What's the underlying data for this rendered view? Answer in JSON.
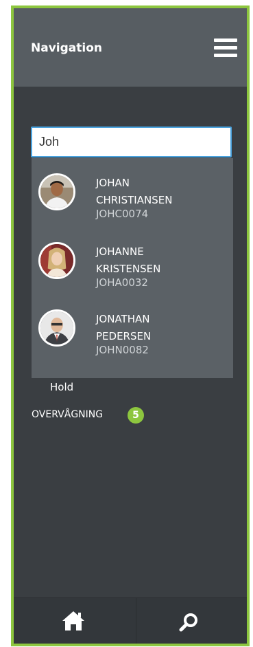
{
  "header": {
    "title": "Navigation",
    "menu_icon": "hamburger-menu-icon"
  },
  "search": {
    "value": "Joh",
    "placeholder": ""
  },
  "results": [
    {
      "first": "JOHAN",
      "last": "CHRISTIANSEN",
      "code": "JOHC0074"
    },
    {
      "first": "JOHANNE",
      "last": "KRISTENSEN",
      "code": "JOHA0032"
    },
    {
      "first": "JONATHAN",
      "last": "PEDERSEN",
      "code": "JOHN0082"
    }
  ],
  "menu": {
    "hold_label": "Hold",
    "overvaagning_label": "OVERVÅGNING",
    "overvaagning_count": "5"
  },
  "footer": {
    "home_icon": "home-icon",
    "search_icon": "search-icon"
  },
  "colors": {
    "accent": "#8dc63f",
    "header_bg": "#575d62",
    "panel_bg": "#3a3e42",
    "dropdown_bg": "#5b6166",
    "input_border": "#4aa3df"
  }
}
